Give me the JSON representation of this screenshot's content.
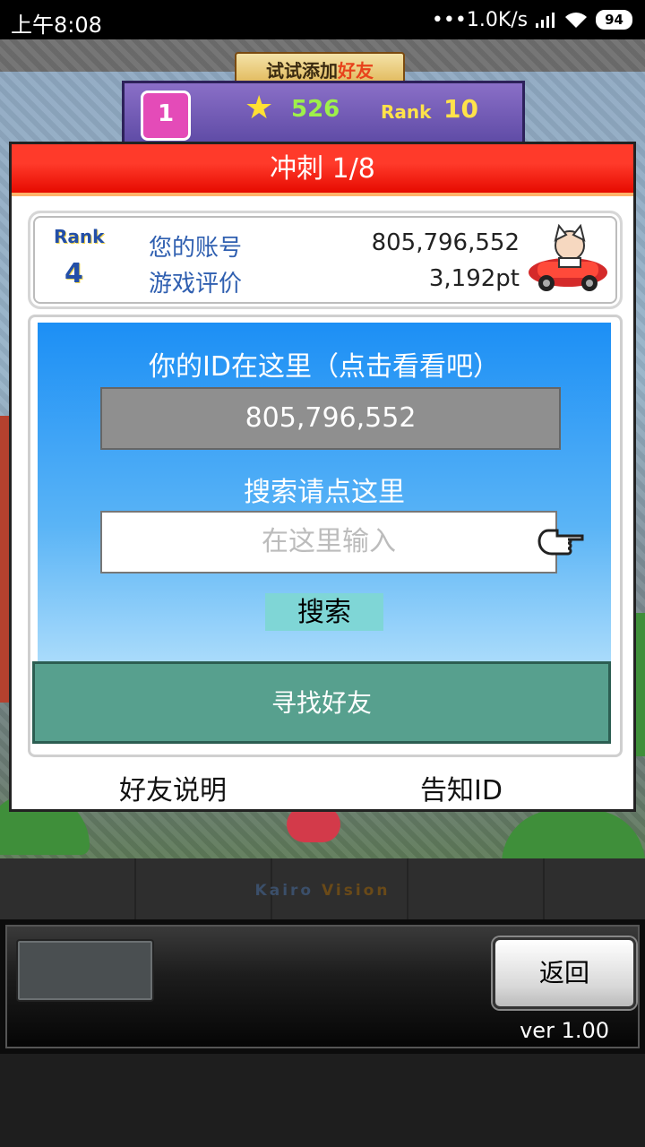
{
  "status_bar": {
    "time": "上午8:08",
    "network_speed": "•••1.0K/s",
    "battery": "94"
  },
  "game_header": {
    "promo_banner": {
      "prefix": "试试添加",
      "highlight": "好友"
    },
    "level": "1",
    "stars": "526",
    "rank_label": "Rank",
    "rank_value": "10"
  },
  "modal": {
    "title": "冲刺 1/8",
    "account": {
      "rank_label": "Rank",
      "rank_value": "4",
      "account_label": "您的账号",
      "account_value": "805,796,552",
      "rating_label": "游戏评价",
      "rating_value": "3,192pt"
    },
    "id_section": {
      "heading": "你的ID在这里（点击看看吧）",
      "id_value": "805,796,552",
      "search_heading": "搜索请点这里",
      "search_placeholder": "在这里输入",
      "search_button": "搜索",
      "find_friend_button": "寻找好友"
    },
    "links": {
      "friend_help": "好友说明",
      "notify_id": "告知ID"
    }
  },
  "footer": {
    "logo_part1": "Kairo",
    "logo_part2": "Vision",
    "back_button": "返回",
    "version": "ver 1.00"
  },
  "colors": {
    "title_red": "#ff3a2a",
    "panel_blue": "#1c8ff5",
    "find_friend_green": "#57a08e",
    "search_button_cyan": "#7fd6d6"
  }
}
